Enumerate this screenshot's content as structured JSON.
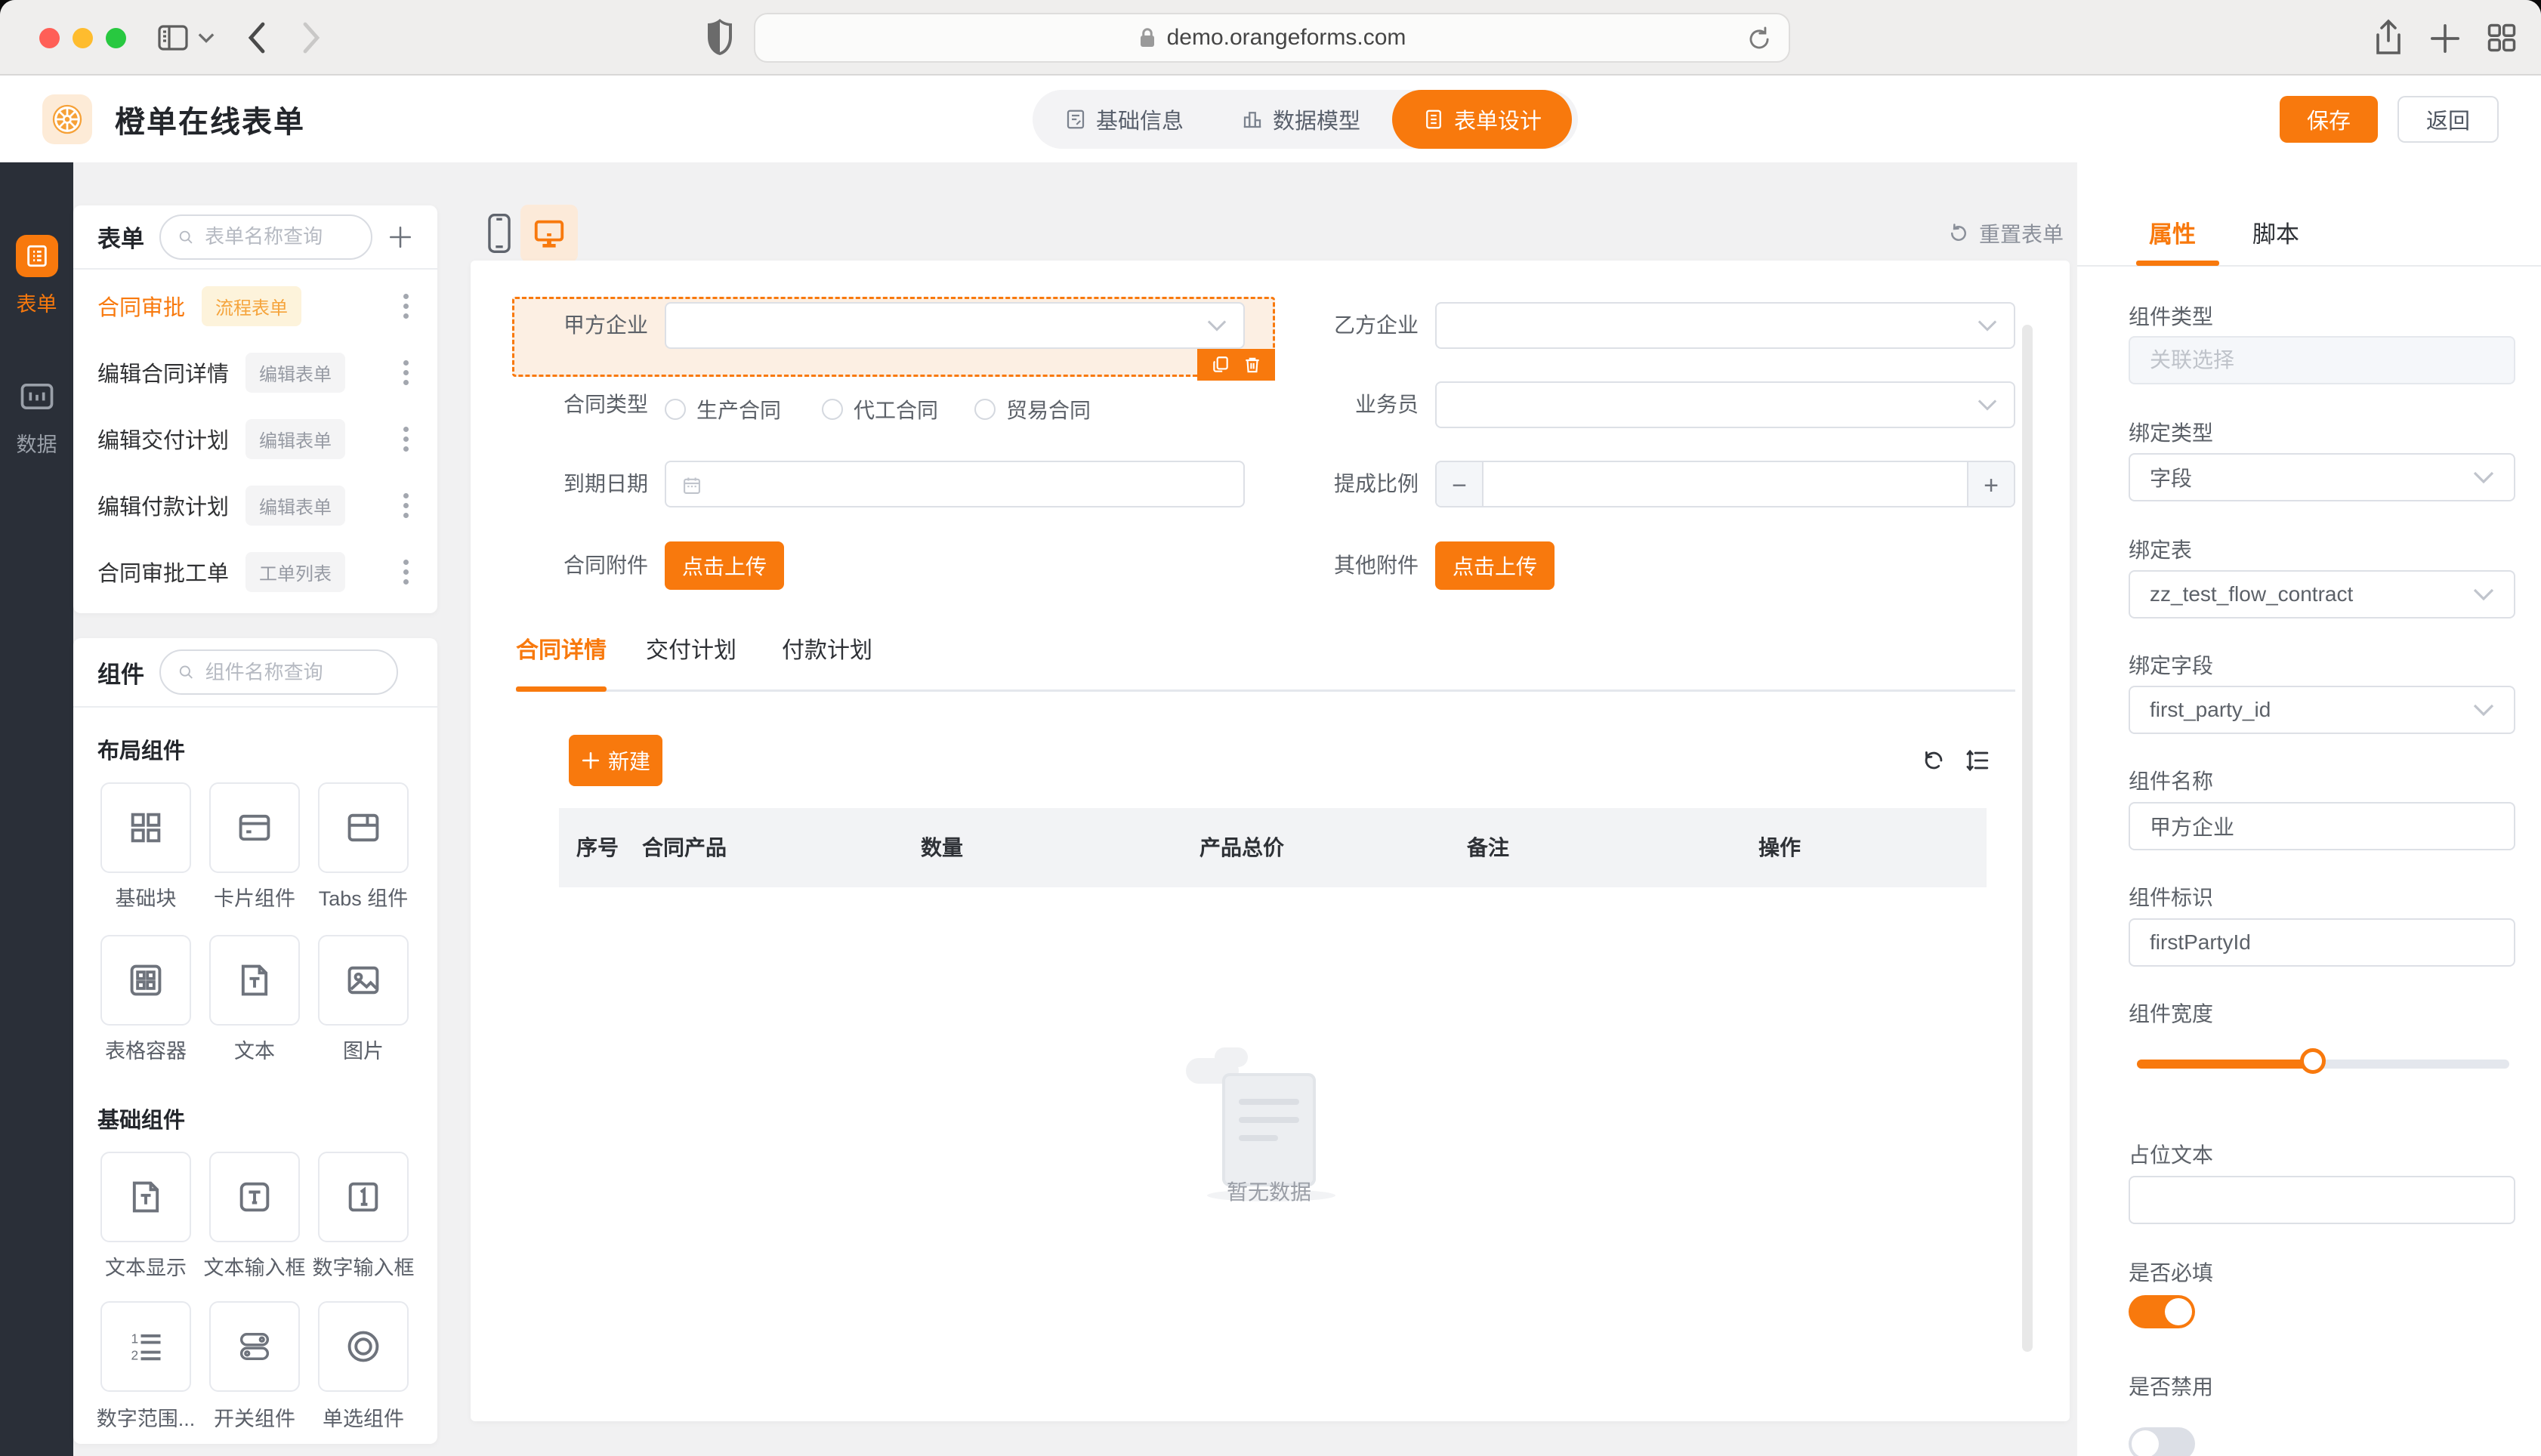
{
  "colors": {
    "accent": "#F8790D",
    "accent_light_bg": "#FCEFE3",
    "badge_orange_bg": "#FDF3DB",
    "badge_orange_text": "#F5A43C",
    "rail_bg": "#2A2F38",
    "traffic_red": "#FF5F57",
    "traffic_yellow": "#FEBC2E",
    "traffic_green": "#28C840"
  },
  "browser": {
    "url": "demo.orangeforms.com"
  },
  "app_header": {
    "title": "橙单在线表单",
    "nav_tabs": [
      {
        "label": "基础信息"
      },
      {
        "label": "数据模型"
      },
      {
        "label": "表单设计",
        "active": true
      }
    ],
    "save_label": "保存",
    "back_label": "返回"
  },
  "rail": {
    "items": [
      {
        "label": "表单",
        "active": true
      },
      {
        "label": "数据",
        "active": false
      }
    ]
  },
  "forms_panel": {
    "title": "表单",
    "search_placeholder": "表单名称查询",
    "items": [
      {
        "name": "合同审批",
        "badge": "流程表单",
        "highlight": true
      },
      {
        "name": "编辑合同详情",
        "badge": "编辑表单"
      },
      {
        "name": "编辑交付计划",
        "badge": "编辑表单"
      },
      {
        "name": "编辑付款计划",
        "badge": "编辑表单"
      },
      {
        "name": "合同审批工单",
        "badge": "工单列表"
      }
    ]
  },
  "components_panel": {
    "title": "组件",
    "search_placeholder": "组件名称查询",
    "layout_section": {
      "title": "布局组件",
      "items": [
        {
          "label": "基础块"
        },
        {
          "label": "卡片组件"
        },
        {
          "label": "Tabs 组件"
        },
        {
          "label": "表格容器"
        },
        {
          "label": "文本"
        },
        {
          "label": "图片"
        }
      ]
    },
    "basic_section": {
      "title": "基础组件",
      "items": [
        {
          "label": "文本显示"
        },
        {
          "label": "文本输入框"
        },
        {
          "label": "数字输入框"
        },
        {
          "label": "数字范围..."
        },
        {
          "label": "开关组件"
        },
        {
          "label": "单选组件"
        }
      ]
    }
  },
  "canvas": {
    "reset_label": "重置表单",
    "fields": {
      "first_party": {
        "label": "甲方企业"
      },
      "second_party": {
        "label": "乙方企业"
      },
      "contract_type": {
        "label": "合同类型",
        "options": [
          "生产合同",
          "代工合同",
          "贸易合同"
        ]
      },
      "salesman": {
        "label": "业务员"
      },
      "due_date": {
        "label": "到期日期"
      },
      "commission": {
        "label": "提成比例"
      },
      "contract_attachment": {
        "label": "合同附件",
        "button": "点击上传"
      },
      "other_attachment": {
        "label": "其他附件",
        "button": "点击上传"
      }
    },
    "detail_tabs": [
      {
        "label": "合同详情",
        "active": true
      },
      {
        "label": "交付计划"
      },
      {
        "label": "付款计划"
      }
    ],
    "detail": {
      "new_button": "新建",
      "columns": [
        "序号",
        "合同产品",
        "数量",
        "产品总价",
        "备注",
        "操作"
      ],
      "empty_text": "暂无数据"
    }
  },
  "props": {
    "tabs": [
      {
        "label": "属性",
        "active": true
      },
      {
        "label": "脚本"
      }
    ],
    "fields": {
      "component_type": {
        "label": "组件类型",
        "placeholder": "关联选择"
      },
      "bind_type": {
        "label": "绑定类型",
        "value": "字段"
      },
      "bind_table": {
        "label": "绑定表",
        "value": "zz_test_flow_contract"
      },
      "bind_field": {
        "label": "绑定字段",
        "value": "first_party_id"
      },
      "component_name": {
        "label": "组件名称",
        "value": "甲方企业"
      },
      "component_key": {
        "label": "组件标识",
        "value": "firstPartyId"
      },
      "component_width": {
        "label": "组件宽度",
        "value_percent": 48
      },
      "placeholder_text": {
        "label": "占位文本",
        "value": ""
      },
      "required": {
        "label": "是否必填",
        "value": true
      },
      "disabled": {
        "label": "是否禁用",
        "value": false
      }
    }
  }
}
